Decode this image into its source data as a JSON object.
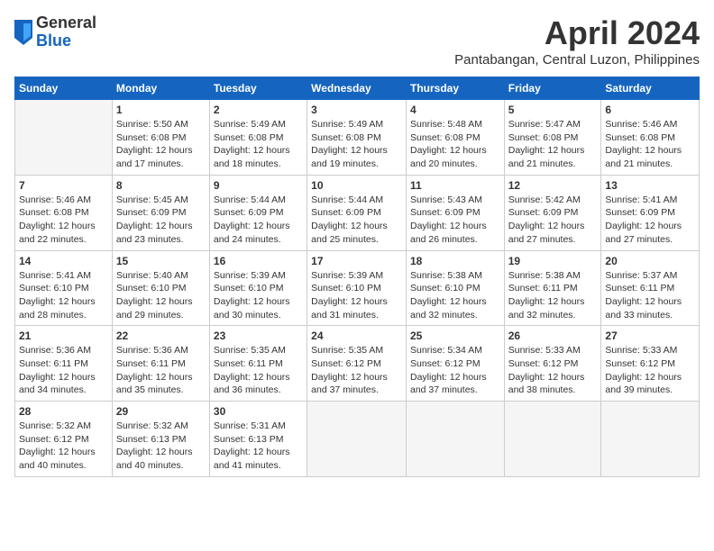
{
  "header": {
    "logo_general": "General",
    "logo_blue": "Blue",
    "month_title": "April 2024",
    "location": "Pantabangan, Central Luzon, Philippines"
  },
  "weekdays": [
    "Sunday",
    "Monday",
    "Tuesday",
    "Wednesday",
    "Thursday",
    "Friday",
    "Saturday"
  ],
  "weeks": [
    [
      {
        "day": "",
        "info": ""
      },
      {
        "day": "1",
        "info": "Sunrise: 5:50 AM\nSunset: 6:08 PM\nDaylight: 12 hours\nand 17 minutes."
      },
      {
        "day": "2",
        "info": "Sunrise: 5:49 AM\nSunset: 6:08 PM\nDaylight: 12 hours\nand 18 minutes."
      },
      {
        "day": "3",
        "info": "Sunrise: 5:49 AM\nSunset: 6:08 PM\nDaylight: 12 hours\nand 19 minutes."
      },
      {
        "day": "4",
        "info": "Sunrise: 5:48 AM\nSunset: 6:08 PM\nDaylight: 12 hours\nand 20 minutes."
      },
      {
        "day": "5",
        "info": "Sunrise: 5:47 AM\nSunset: 6:08 PM\nDaylight: 12 hours\nand 21 minutes."
      },
      {
        "day": "6",
        "info": "Sunrise: 5:46 AM\nSunset: 6:08 PM\nDaylight: 12 hours\nand 21 minutes."
      }
    ],
    [
      {
        "day": "7",
        "info": "Sunrise: 5:46 AM\nSunset: 6:08 PM\nDaylight: 12 hours\nand 22 minutes."
      },
      {
        "day": "8",
        "info": "Sunrise: 5:45 AM\nSunset: 6:09 PM\nDaylight: 12 hours\nand 23 minutes."
      },
      {
        "day": "9",
        "info": "Sunrise: 5:44 AM\nSunset: 6:09 PM\nDaylight: 12 hours\nand 24 minutes."
      },
      {
        "day": "10",
        "info": "Sunrise: 5:44 AM\nSunset: 6:09 PM\nDaylight: 12 hours\nand 25 minutes."
      },
      {
        "day": "11",
        "info": "Sunrise: 5:43 AM\nSunset: 6:09 PM\nDaylight: 12 hours\nand 26 minutes."
      },
      {
        "day": "12",
        "info": "Sunrise: 5:42 AM\nSunset: 6:09 PM\nDaylight: 12 hours\nand 27 minutes."
      },
      {
        "day": "13",
        "info": "Sunrise: 5:41 AM\nSunset: 6:09 PM\nDaylight: 12 hours\nand 27 minutes."
      }
    ],
    [
      {
        "day": "14",
        "info": "Sunrise: 5:41 AM\nSunset: 6:10 PM\nDaylight: 12 hours\nand 28 minutes."
      },
      {
        "day": "15",
        "info": "Sunrise: 5:40 AM\nSunset: 6:10 PM\nDaylight: 12 hours\nand 29 minutes."
      },
      {
        "day": "16",
        "info": "Sunrise: 5:39 AM\nSunset: 6:10 PM\nDaylight: 12 hours\nand 30 minutes."
      },
      {
        "day": "17",
        "info": "Sunrise: 5:39 AM\nSunset: 6:10 PM\nDaylight: 12 hours\nand 31 minutes."
      },
      {
        "day": "18",
        "info": "Sunrise: 5:38 AM\nSunset: 6:10 PM\nDaylight: 12 hours\nand 32 minutes."
      },
      {
        "day": "19",
        "info": "Sunrise: 5:38 AM\nSunset: 6:11 PM\nDaylight: 12 hours\nand 32 minutes."
      },
      {
        "day": "20",
        "info": "Sunrise: 5:37 AM\nSunset: 6:11 PM\nDaylight: 12 hours\nand 33 minutes."
      }
    ],
    [
      {
        "day": "21",
        "info": "Sunrise: 5:36 AM\nSunset: 6:11 PM\nDaylight: 12 hours\nand 34 minutes."
      },
      {
        "day": "22",
        "info": "Sunrise: 5:36 AM\nSunset: 6:11 PM\nDaylight: 12 hours\nand 35 minutes."
      },
      {
        "day": "23",
        "info": "Sunrise: 5:35 AM\nSunset: 6:11 PM\nDaylight: 12 hours\nand 36 minutes."
      },
      {
        "day": "24",
        "info": "Sunrise: 5:35 AM\nSunset: 6:12 PM\nDaylight: 12 hours\nand 37 minutes."
      },
      {
        "day": "25",
        "info": "Sunrise: 5:34 AM\nSunset: 6:12 PM\nDaylight: 12 hours\nand 37 minutes."
      },
      {
        "day": "26",
        "info": "Sunrise: 5:33 AM\nSunset: 6:12 PM\nDaylight: 12 hours\nand 38 minutes."
      },
      {
        "day": "27",
        "info": "Sunrise: 5:33 AM\nSunset: 6:12 PM\nDaylight: 12 hours\nand 39 minutes."
      }
    ],
    [
      {
        "day": "28",
        "info": "Sunrise: 5:32 AM\nSunset: 6:12 PM\nDaylight: 12 hours\nand 40 minutes."
      },
      {
        "day": "29",
        "info": "Sunrise: 5:32 AM\nSunset: 6:13 PM\nDaylight: 12 hours\nand 40 minutes."
      },
      {
        "day": "30",
        "info": "Sunrise: 5:31 AM\nSunset: 6:13 PM\nDaylight: 12 hours\nand 41 minutes."
      },
      {
        "day": "",
        "info": ""
      },
      {
        "day": "",
        "info": ""
      },
      {
        "day": "",
        "info": ""
      },
      {
        "day": "",
        "info": ""
      }
    ]
  ]
}
